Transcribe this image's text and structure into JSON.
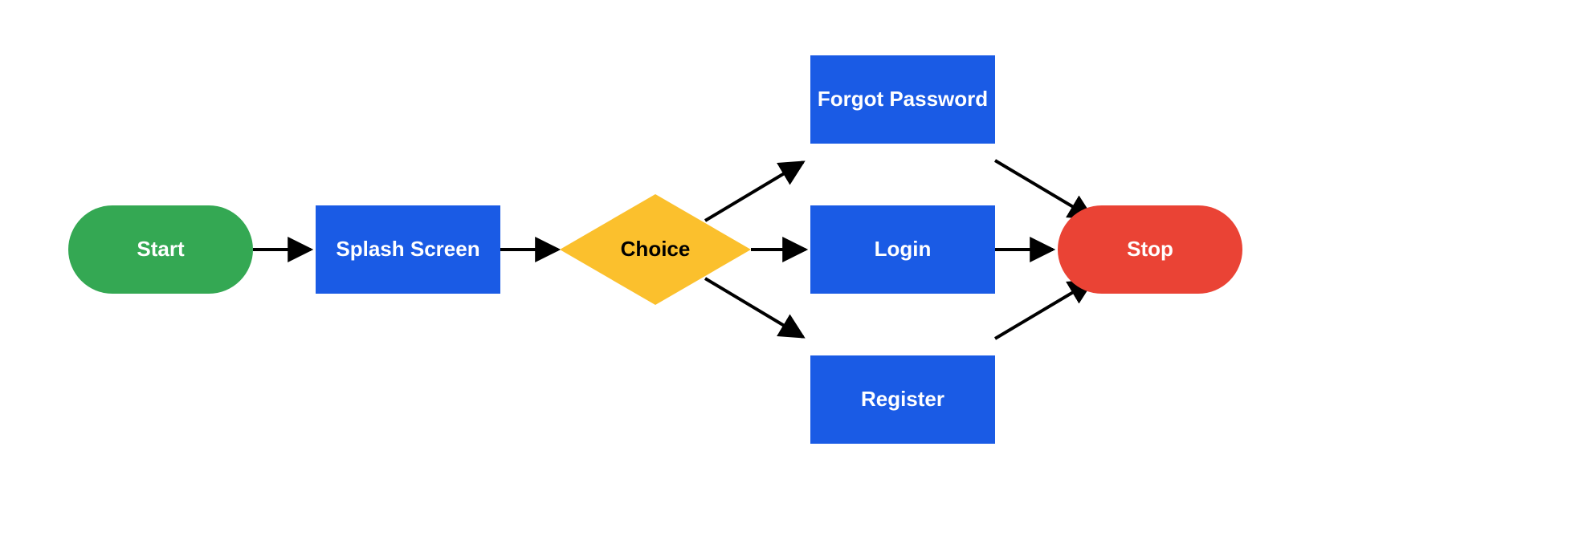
{
  "colors": {
    "green": "#34a853",
    "blue": "#1a5be5",
    "yellow": "#fbc02d",
    "red": "#ea4335",
    "line": "#000000"
  },
  "nodes": {
    "start": "Start",
    "splash": "Splash Screen",
    "choice": "Choice",
    "forgot": "Forgot Password",
    "login": "Login",
    "register": "Register",
    "stop": "Stop"
  }
}
